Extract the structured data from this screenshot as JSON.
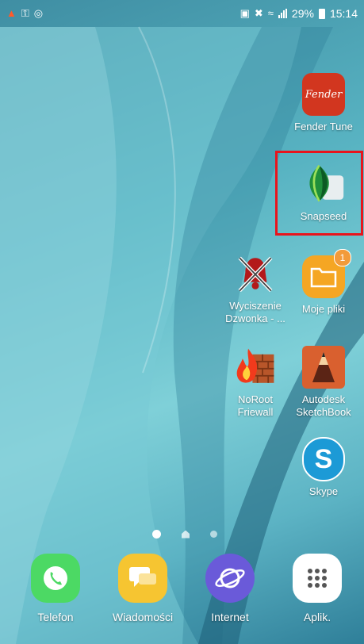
{
  "status_bar": {
    "battery": "29%",
    "time": "15:14"
  },
  "home": {
    "apps": [
      {
        "name": "fender-tune",
        "label": "Fender Tune",
        "icon_text": "Fender"
      },
      {
        "name": "snapseed",
        "label": "Snapseed"
      },
      {
        "name": "wyciszenie",
        "label": "Wyciszenie Dzwonka - ..."
      },
      {
        "name": "moje-pliki",
        "label": "Moje pliki",
        "badge": "1"
      },
      {
        "name": "noroot-firewall",
        "label": "NoRoot Friewall"
      },
      {
        "name": "autodesk-sketchbook",
        "label": "Autodesk SketchBook"
      },
      {
        "name": "skype",
        "label": "Skype",
        "icon_text": "S"
      }
    ]
  },
  "dock": {
    "items": [
      {
        "label": "Telefon"
      },
      {
        "label": "Wiadomości"
      },
      {
        "label": "Internet"
      },
      {
        "label": "Aplik."
      }
    ]
  },
  "colors": {
    "highlight": "#e8141c",
    "fender_bg": "#d2361f",
    "files_bg": "#f5a623",
    "sketchbook_bg": "#d9602f",
    "skype_blue": "#1c9ad6",
    "phone_green": "#4cd964",
    "messages_yellow": "#f6c531",
    "internet_purple": "#6a5ad9"
  }
}
